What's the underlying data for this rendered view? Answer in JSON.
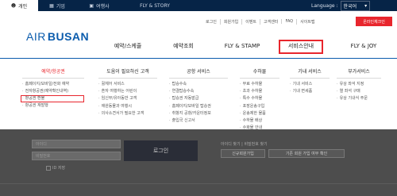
{
  "top_tabs": [
    {
      "label": "개인",
      "icon": "person-icon"
    },
    {
      "label": "기업",
      "icon": "building-icon"
    },
    {
      "label": "여행사",
      "icon": "suitcase-icon"
    },
    {
      "label": "FLY & STORY",
      "icon": ""
    }
  ],
  "language": {
    "label": "Language :",
    "value": "한국어"
  },
  "utility_links": [
    "로그인",
    "회원가입",
    "이벤트",
    "고객센터",
    "FAQ",
    "사이트맵"
  ],
  "checkin_button": "온라인체크인",
  "logo": {
    "air": "AIR",
    "busan": "BUSAN"
  },
  "nav": [
    "예약/스케줄",
    "예약조회",
    "FLY & STAMP",
    "서비스안내",
    "FLY & JOY"
  ],
  "mega_menu": [
    {
      "heading": "예약/항공권",
      "items": [
        "홈페이지/모바일/전화 예약",
        "전자항공권(예약확인내역)",
        "항공권 환불",
        "항공권 재발행"
      ]
    },
    {
      "heading": "도움이 필요하신 고객",
      "items": [
        "휠체어 서비스",
        "혼자 여행하는 어린이",
        "임신부/유아동반 고객",
        "애완동물과 여행시",
        "의사소견서가 필요한 고객"
      ]
    },
    {
      "heading": "공항 서비스",
      "items": [
        "탑승수속",
        "연결탑승수속",
        "탑승권 자동발급",
        "홈페이지/모바일 탑승권",
        "취항지 공항/카운터정보",
        "출입국 신고서"
      ]
    },
    {
      "heading": "수하물",
      "items": [
        "무료 수하물",
        "초과 수하물",
        "특수 수하물",
        "포장운송구입",
        "운송제한 물품",
        "수하물 배상",
        "수화물 안내"
      ]
    },
    {
      "heading": "기내 서비스",
      "items": [
        "기내 서비스",
        "기내 면세품"
      ]
    },
    {
      "heading": "부가서비스",
      "items": [
        "유상 좌석 지정",
        "열 좌석 구매",
        "유상 기내식 주문"
      ]
    }
  ],
  "login_overlay": {
    "id_placeholder": "아이디",
    "pw_placeholder": "비밀번호",
    "login_button": "로그인",
    "find_links": "아이디 찾기  |  비밀번호 찾기",
    "signup_button": "신규회원가입",
    "existing_button": "기존 회원 가입 여부 확인",
    "remember_label": "ID 저장"
  },
  "colors": {
    "brand_blue": "#0b5cad",
    "accent_red": "#e8262d",
    "top_bar": "#062447"
  }
}
